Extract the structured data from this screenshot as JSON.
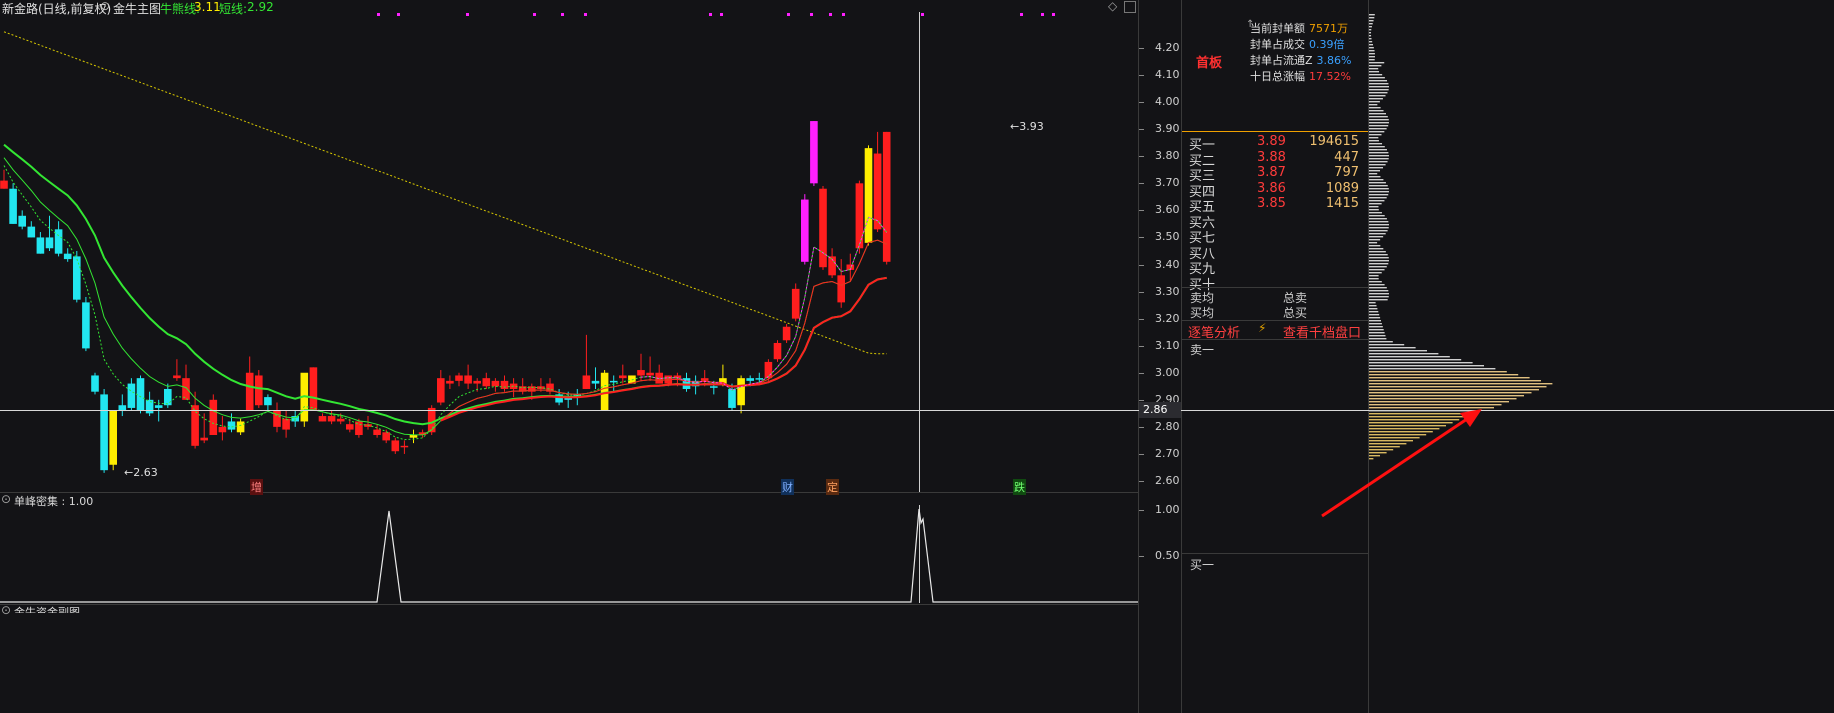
{
  "header": {
    "stock_title": "新金路(日线,前复权)",
    "indicator_name": "金牛主图",
    "niu_line_label": "牛熊线:",
    "niu_line_value": "3.11",
    "short_line_label": "短线:",
    "short_line_value": "2.92"
  },
  "subpanel": {
    "title": "单峰密集 : 1.00",
    "axis_ticks": [
      "1.00",
      "0.50"
    ],
    "bottom_title": "金牛资金副图"
  },
  "price_axis": {
    "ticks": [
      "4.20",
      "4.10",
      "4.00",
      "3.90",
      "3.80",
      "3.70",
      "3.60",
      "3.50",
      "3.40",
      "3.30",
      "3.20",
      "3.10",
      "3.00",
      "2.90",
      "2.80",
      "2.70",
      "2.60"
    ],
    "crosshair_price": "2.86"
  },
  "annotations": {
    "high_label": "3.93",
    "low_label": "2.63",
    "event_marks": [
      {
        "text": "增",
        "color": "#ff5a5a"
      },
      {
        "text": "财",
        "color": "#5aa0ff"
      },
      {
        "text": "定",
        "color": "#ff8a3a"
      },
      {
        "text": "跌",
        "color": "#3ad03a"
      }
    ]
  },
  "right_panel": {
    "board_tag": "首板",
    "stats": [
      {
        "label": "当前封单额",
        "value": "7571万",
        "color": "#f0a000"
      },
      {
        "label": "封单占成交",
        "value": "0.39倍",
        "color": "#3aa0ff"
      },
      {
        "label": "封单占流通Z",
        "value": "3.86%",
        "color": "#3aa0ff"
      },
      {
        "label": "十日总涨幅",
        "value": "17.52%",
        "color": "#ff3b3b"
      }
    ],
    "bids": [
      {
        "name": "买一",
        "price": "3.89",
        "vol": "194615"
      },
      {
        "name": "买二",
        "price": "3.88",
        "vol": "447"
      },
      {
        "name": "买三",
        "price": "3.87",
        "vol": "797"
      },
      {
        "name": "买四",
        "price": "3.86",
        "vol": "1089"
      },
      {
        "name": "买五",
        "price": "3.85",
        "vol": "1415"
      },
      {
        "name": "买六",
        "price": "",
        "vol": ""
      },
      {
        "name": "买七",
        "price": "",
        "vol": ""
      },
      {
        "name": "买八",
        "price": "",
        "vol": ""
      },
      {
        "name": "买九",
        "price": "",
        "vol": ""
      },
      {
        "name": "买十",
        "price": "",
        "vol": ""
      }
    ],
    "avg_sell": "卖均",
    "total_sell": "总卖",
    "avg_buy": "买均",
    "total_buy": "总买",
    "tick_analysis": "逐笔分析",
    "lightning_icon": "⚡",
    "view_ten_levels": "查看千档盘口",
    "ask_one": "卖一",
    "bottom_bid": "买一"
  },
  "colors": {
    "up": "#ff1e1e",
    "down": "#22e6f0",
    "limit_up": "#ff20ff",
    "special": "#ffee00",
    "ma_green": "#33e633",
    "ma_red": "#ff2020",
    "bull_bear_line": "#d8c800"
  },
  "chart_data": {
    "type": "candlestick",
    "ylim": [
      2.55,
      4.27
    ],
    "candles": [
      {
        "o": 3.71,
        "h": 3.75,
        "l": 3.68,
        "c": 3.68,
        "k": "up"
      },
      {
        "o": 3.68,
        "h": 3.7,
        "l": 3.55,
        "c": 3.55,
        "k": "down"
      },
      {
        "o": 3.58,
        "h": 3.6,
        "l": 3.53,
        "c": 3.54,
        "k": "down"
      },
      {
        "o": 3.54,
        "h": 3.56,
        "l": 3.5,
        "c": 3.5,
        "k": "down"
      },
      {
        "o": 3.5,
        "h": 3.52,
        "l": 3.44,
        "c": 3.44,
        "k": "down"
      },
      {
        "o": 3.5,
        "h": 3.58,
        "l": 3.45,
        "c": 3.46,
        "k": "down"
      },
      {
        "o": 3.53,
        "h": 3.56,
        "l": 3.43,
        "c": 3.44,
        "k": "down"
      },
      {
        "o": 3.44,
        "h": 3.46,
        "l": 3.41,
        "c": 3.42,
        "k": "down"
      },
      {
        "o": 3.43,
        "h": 3.45,
        "l": 3.26,
        "c": 3.27,
        "k": "down"
      },
      {
        "o": 3.26,
        "h": 3.28,
        "l": 3.08,
        "c": 3.09,
        "k": "down"
      },
      {
        "o": 2.99,
        "h": 3.0,
        "l": 2.92,
        "c": 2.93,
        "k": "down"
      },
      {
        "o": 2.92,
        "h": 2.94,
        "l": 2.63,
        "c": 2.64,
        "k": "down"
      },
      {
        "o": 2.66,
        "h": 2.86,
        "l": 2.64,
        "c": 2.86,
        "k": "yellow"
      },
      {
        "o": 2.88,
        "h": 2.92,
        "l": 2.84,
        "c": 2.86,
        "k": "down"
      },
      {
        "o": 2.96,
        "h": 2.98,
        "l": 2.86,
        "c": 2.87,
        "k": "down"
      },
      {
        "o": 2.98,
        "h": 2.99,
        "l": 2.85,
        "c": 2.86,
        "k": "down"
      },
      {
        "o": 2.9,
        "h": 2.93,
        "l": 2.84,
        "c": 2.85,
        "k": "down"
      },
      {
        "o": 2.88,
        "h": 2.9,
        "l": 2.82,
        "c": 2.87,
        "k": "down"
      },
      {
        "o": 2.94,
        "h": 2.96,
        "l": 2.87,
        "c": 2.88,
        "k": "down"
      },
      {
        "o": 2.99,
        "h": 3.05,
        "l": 2.97,
        "c": 2.98,
        "k": "up"
      },
      {
        "o": 2.98,
        "h": 3.03,
        "l": 2.9,
        "c": 2.9,
        "k": "up"
      },
      {
        "o": 2.88,
        "h": 2.93,
        "l": 2.72,
        "c": 2.73,
        "k": "up"
      },
      {
        "o": 2.75,
        "h": 2.85,
        "l": 2.74,
        "c": 2.76,
        "k": "up"
      },
      {
        "o": 2.9,
        "h": 2.92,
        "l": 2.77,
        "c": 2.77,
        "k": "up"
      },
      {
        "o": 2.8,
        "h": 2.84,
        "l": 2.75,
        "c": 2.78,
        "k": "up"
      },
      {
        "o": 2.82,
        "h": 2.85,
        "l": 2.78,
        "c": 2.79,
        "k": "down"
      },
      {
        "o": 2.78,
        "h": 2.83,
        "l": 2.77,
        "c": 2.82,
        "k": "yellow"
      },
      {
        "o": 3.0,
        "h": 3.06,
        "l": 2.86,
        "c": 2.86,
        "k": "up"
      },
      {
        "o": 2.99,
        "h": 3.01,
        "l": 2.87,
        "c": 2.88,
        "k": "up"
      },
      {
        "o": 2.88,
        "h": 2.92,
        "l": 2.86,
        "c": 2.91,
        "k": "down"
      },
      {
        "o": 2.86,
        "h": 2.89,
        "l": 2.78,
        "c": 2.8,
        "k": "up"
      },
      {
        "o": 2.83,
        "h": 2.86,
        "l": 2.76,
        "c": 2.79,
        "k": "up"
      },
      {
        "o": 2.84,
        "h": 2.86,
        "l": 2.8,
        "c": 2.82,
        "k": "down"
      },
      {
        "o": 2.82,
        "h": 2.99,
        "l": 2.8,
        "c": 3.0,
        "k": "yellow"
      },
      {
        "o": 3.02,
        "h": 3.02,
        "l": 2.87,
        "c": 2.86,
        "k": "up"
      },
      {
        "o": 2.84,
        "h": 2.85,
        "l": 2.82,
        "c": 2.82,
        "k": "up"
      },
      {
        "o": 2.84,
        "h": 2.86,
        "l": 2.81,
        "c": 2.82,
        "k": "up"
      },
      {
        "o": 2.83,
        "h": 2.85,
        "l": 2.81,
        "c": 2.82,
        "k": "up"
      },
      {
        "o": 2.81,
        "h": 2.83,
        "l": 2.78,
        "c": 2.79,
        "k": "up"
      },
      {
        "o": 2.82,
        "h": 2.83,
        "l": 2.76,
        "c": 2.77,
        "k": "up"
      },
      {
        "o": 2.81,
        "h": 2.84,
        "l": 2.79,
        "c": 2.8,
        "k": "up"
      },
      {
        "o": 2.79,
        "h": 2.81,
        "l": 2.76,
        "c": 2.77,
        "k": "up"
      },
      {
        "o": 2.78,
        "h": 2.79,
        "l": 2.74,
        "c": 2.75,
        "k": "up"
      },
      {
        "o": 2.75,
        "h": 2.76,
        "l": 2.7,
        "c": 2.71,
        "k": "up"
      },
      {
        "o": 2.73,
        "h": 2.75,
        "l": 2.7,
        "c": 2.73,
        "k": "up"
      },
      {
        "o": 2.77,
        "h": 2.79,
        "l": 2.74,
        "c": 2.76,
        "k": "yellow"
      },
      {
        "o": 2.78,
        "h": 2.79,
        "l": 2.76,
        "c": 2.77,
        "k": "up"
      },
      {
        "o": 2.78,
        "h": 2.88,
        "l": 2.77,
        "c": 2.87,
        "k": "up"
      },
      {
        "o": 2.89,
        "h": 3.01,
        "l": 2.88,
        "c": 2.98,
        "k": "up"
      },
      {
        "o": 2.96,
        "h": 2.99,
        "l": 2.94,
        "c": 2.97,
        "k": "up"
      },
      {
        "o": 2.97,
        "h": 3.0,
        "l": 2.95,
        "c": 2.99,
        "k": "up"
      },
      {
        "o": 2.99,
        "h": 3.03,
        "l": 2.94,
        "c": 2.96,
        "k": "up"
      },
      {
        "o": 2.96,
        "h": 2.98,
        "l": 2.93,
        "c": 2.97,
        "k": "up"
      },
      {
        "o": 2.98,
        "h": 3.0,
        "l": 2.94,
        "c": 2.95,
        "k": "up"
      },
      {
        "o": 2.95,
        "h": 2.98,
        "l": 2.93,
        "c": 2.97,
        "k": "up"
      },
      {
        "o": 2.97,
        "h": 2.99,
        "l": 2.93,
        "c": 2.94,
        "k": "up"
      },
      {
        "o": 2.94,
        "h": 2.98,
        "l": 2.91,
        "c": 2.96,
        "k": "up"
      },
      {
        "o": 2.95,
        "h": 2.98,
        "l": 2.92,
        "c": 2.93,
        "k": "up"
      },
      {
        "o": 2.93,
        "h": 2.96,
        "l": 2.9,
        "c": 2.95,
        "k": "up"
      },
      {
        "o": 2.95,
        "h": 2.98,
        "l": 2.93,
        "c": 2.94,
        "k": "up"
      },
      {
        "o": 2.96,
        "h": 2.98,
        "l": 2.92,
        "c": 2.93,
        "k": "up"
      },
      {
        "o": 2.92,
        "h": 2.94,
        "l": 2.88,
        "c": 2.89,
        "k": "down"
      },
      {
        "o": 2.91,
        "h": 2.93,
        "l": 2.87,
        "c": 2.9,
        "k": "down"
      },
      {
        "o": 2.92,
        "h": 2.94,
        "l": 2.88,
        "c": 2.91,
        "k": "down"
      },
      {
        "o": 2.99,
        "h": 3.14,
        "l": 2.94,
        "c": 2.94,
        "k": "up"
      },
      {
        "o": 2.97,
        "h": 3.02,
        "l": 2.94,
        "c": 2.96,
        "k": "down"
      },
      {
        "o": 2.86,
        "h": 3.01,
        "l": 2.86,
        "c": 3.0,
        "k": "yellow"
      },
      {
        "o": 2.97,
        "h": 2.99,
        "l": 2.93,
        "c": 2.97,
        "k": "down"
      },
      {
        "o": 2.98,
        "h": 3.03,
        "l": 2.96,
        "c": 2.99,
        "k": "up"
      },
      {
        "o": 2.96,
        "h": 2.99,
        "l": 2.96,
        "c": 2.99,
        "k": "yellow"
      },
      {
        "o": 2.99,
        "h": 3.07,
        "l": 2.97,
        "c": 3.01,
        "k": "up"
      },
      {
        "o": 3.0,
        "h": 3.06,
        "l": 2.97,
        "c": 2.99,
        "k": "up"
      },
      {
        "o": 3.0,
        "h": 3.03,
        "l": 2.97,
        "c": 2.96,
        "k": "up"
      },
      {
        "o": 2.96,
        "h": 2.99,
        "l": 2.95,
        "c": 2.99,
        "k": "up"
      },
      {
        "o": 2.99,
        "h": 3.0,
        "l": 2.95,
        "c": 2.98,
        "k": "up"
      },
      {
        "o": 2.98,
        "h": 3.0,
        "l": 2.93,
        "c": 2.94,
        "k": "down"
      },
      {
        "o": 2.97,
        "h": 2.99,
        "l": 2.92,
        "c": 2.95,
        "k": "down"
      },
      {
        "o": 2.97,
        "h": 3.01,
        "l": 2.95,
        "c": 2.98,
        "k": "up"
      },
      {
        "o": 2.95,
        "h": 2.97,
        "l": 2.92,
        "c": 2.95,
        "k": "down"
      },
      {
        "o": 2.98,
        "h": 3.03,
        "l": 2.95,
        "c": 2.96,
        "k": "yellow"
      },
      {
        "o": 2.94,
        "h": 2.96,
        "l": 2.86,
        "c": 2.87,
        "k": "down"
      },
      {
        "o": 2.88,
        "h": 2.99,
        "l": 2.85,
        "c": 2.98,
        "k": "yellow"
      },
      {
        "o": 2.97,
        "h": 2.99,
        "l": 2.95,
        "c": 2.98,
        "k": "down"
      },
      {
        "o": 2.98,
        "h": 3.0,
        "l": 2.96,
        "c": 2.98,
        "k": "down"
      },
      {
        "o": 2.98,
        "h": 3.05,
        "l": 2.97,
        "c": 3.04,
        "k": "up"
      },
      {
        "o": 3.05,
        "h": 3.12,
        "l": 3.04,
        "c": 3.11,
        "k": "up"
      },
      {
        "o": 3.12,
        "h": 3.18,
        "l": 3.11,
        "c": 3.17,
        "k": "up"
      },
      {
        "o": 3.2,
        "h": 3.33,
        "l": 3.19,
        "c": 3.31,
        "k": "up"
      },
      {
        "o": 3.41,
        "h": 3.66,
        "l": 3.4,
        "c": 3.64,
        "k": "magenta"
      },
      {
        "o": 3.7,
        "h": 3.93,
        "l": 3.69,
        "c": 3.93,
        "k": "magenta"
      },
      {
        "o": 3.68,
        "h": 3.69,
        "l": 3.38,
        "c": 3.39,
        "k": "up"
      },
      {
        "o": 3.43,
        "h": 3.46,
        "l": 3.35,
        "c": 3.36,
        "k": "up"
      },
      {
        "o": 3.36,
        "h": 3.42,
        "l": 3.24,
        "c": 3.26,
        "k": "up"
      },
      {
        "o": 3.38,
        "h": 3.44,
        "l": 3.34,
        "c": 3.4,
        "k": "up"
      },
      {
        "o": 3.46,
        "h": 3.71,
        "l": 3.44,
        "c": 3.7,
        "k": "up"
      },
      {
        "o": 3.48,
        "h": 3.84,
        "l": 3.47,
        "c": 3.83,
        "k": "yellow"
      },
      {
        "o": 3.81,
        "h": 3.89,
        "l": 3.52,
        "c": 3.53,
        "k": "up"
      },
      {
        "o": 3.89,
        "h": 3.89,
        "l": 3.4,
        "c": 3.41,
        "k": "up"
      }
    ],
    "subchart": {
      "title": "单峰密集",
      "ylim": [
        0,
        1.0
      ],
      "peaks": [
        1.0,
        1.0
      ]
    }
  }
}
